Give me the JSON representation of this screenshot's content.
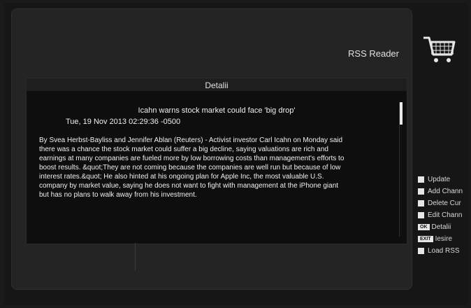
{
  "header": {
    "title": "RSS Reader",
    "cart_icon": "shopping-cart-icon"
  },
  "details": {
    "panel_title": "Detalii",
    "headline": "Icahn warns stock market could face 'big drop'",
    "date": "Tue, 19 Nov 2013 02:29:36 -0500",
    "body": "By Svea Herbst-Bayliss and Jennifer Ablan (Reuters) - Activist investor Carl Icahn on Monday said\n there was a chance the stock market could suffer a big decline, saying valuations are rich and\nearnings at many companies are fueled more by low borrowing costs than management's efforts to\n boost results. &quot;They are not coming because the companies are well run but because of low\ninterest rates.&quot; He also hinted at his ongoing plan for Apple Inc, the most valuable U.S.\ncompany by market value, saying he does not want to fight with management at the iPhone giant\nbut has no plans to walk away from his investment."
  },
  "menu": {
    "items": [
      {
        "label": "Update",
        "key": ""
      },
      {
        "label": "Add Chann",
        "key": ""
      },
      {
        "label": "Delete Cur",
        "key": ""
      },
      {
        "label": "Edit Chann",
        "key": ""
      },
      {
        "label": "Detalii",
        "key": "OK"
      },
      {
        "label": "Iesire",
        "key": "EXIT"
      },
      {
        "label": "Load RSS",
        "key": ""
      }
    ]
  },
  "colors": {
    "background": "#161616",
    "text": "#f0f0f0",
    "accent": "#e6e6e6"
  }
}
